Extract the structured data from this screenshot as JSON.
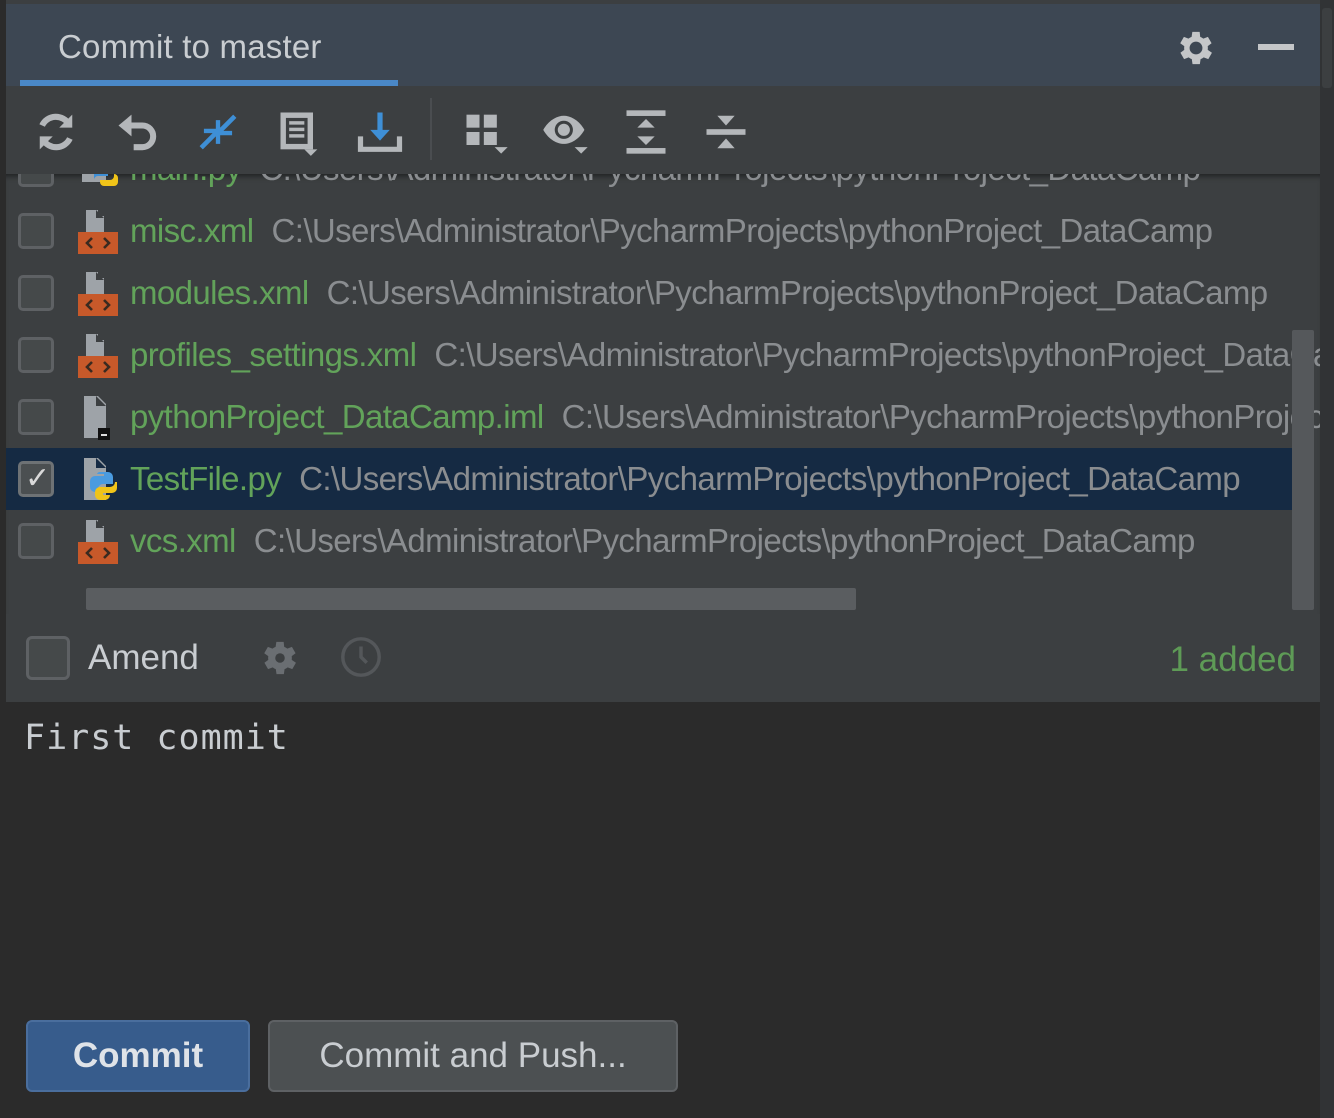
{
  "header": {
    "title": "Commit to master",
    "settings_icon": "gear-icon",
    "minimize_icon": "minimize-icon"
  },
  "toolbar": {
    "buttons": [
      {
        "name": "refresh",
        "icon": "refresh-icon"
      },
      {
        "name": "rollback",
        "icon": "undo-icon"
      },
      {
        "name": "show-diff",
        "icon": "diff-arrows-icon"
      },
      {
        "name": "changelist",
        "icon": "changelist-icon"
      },
      {
        "name": "shelve",
        "icon": "download-icon"
      },
      {
        "name": "group-by",
        "icon": "group-by-icon"
      },
      {
        "name": "view-options",
        "icon": "eye-icon"
      },
      {
        "name": "expand-all",
        "icon": "expand-all-icon"
      },
      {
        "name": "collapse-all",
        "icon": "collapse-all-icon"
      }
    ]
  },
  "files": [
    {
      "name": "main.py",
      "path": "C:\\Users\\Administrator\\PycharmProjects\\pythonProject_DataCamp",
      "type": "python",
      "checked": false,
      "selected": false,
      "partial": true
    },
    {
      "name": "misc.xml",
      "path": "C:\\Users\\Administrator\\PycharmProjects\\pythonProject_DataCamp",
      "type": "xml",
      "checked": false,
      "selected": false
    },
    {
      "name": "modules.xml",
      "path": "C:\\Users\\Administrator\\PycharmProjects\\pythonProject_DataCamp",
      "type": "xml",
      "checked": false,
      "selected": false
    },
    {
      "name": "profiles_settings.xml",
      "path": "C:\\Users\\Administrator\\PycharmProjects\\pythonProject_DataCamp",
      "type": "xml",
      "checked": false,
      "selected": false
    },
    {
      "name": "pythonProject_DataCamp.iml",
      "path": "C:\\Users\\Administrator\\PycharmProjects\\pythonProject_DataCamp",
      "type": "iml",
      "checked": false,
      "selected": false
    },
    {
      "name": "TestFile.py",
      "path": "C:\\Users\\Administrator\\PycharmProjects\\pythonProject_DataCamp",
      "type": "python",
      "checked": true,
      "selected": true
    },
    {
      "name": "vcs.xml",
      "path": "C:\\Users\\Administrator\\PycharmProjects\\pythonProject_DataCamp",
      "type": "xml",
      "checked": false,
      "selected": false
    }
  ],
  "amend": {
    "label": "Amend",
    "checked": false,
    "settings_icon": "gear-icon",
    "history_icon": "clock-icon",
    "status": "1 added"
  },
  "commit_message": {
    "value": "First commit"
  },
  "actions": {
    "commit_label": "Commit",
    "commit_push_label": "Commit and Push..."
  },
  "colors": {
    "accent": "#4a88c7",
    "added_green": "#62a35a",
    "primary_button": "#375c8c",
    "selection": "#152a43"
  }
}
